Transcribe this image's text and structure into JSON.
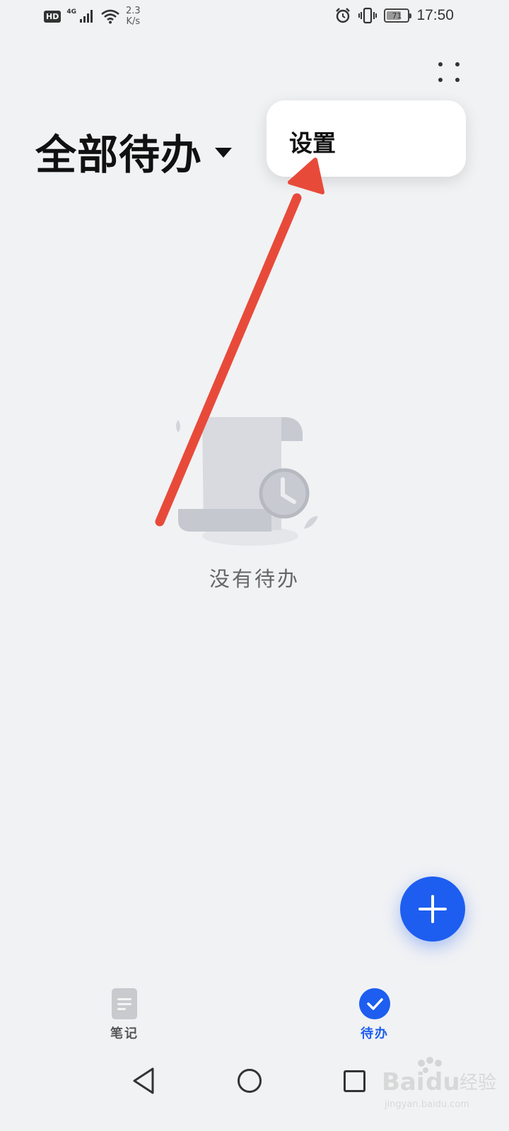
{
  "status_bar": {
    "hd": "HD",
    "network": "4G",
    "speed_value": "2.3",
    "speed_unit": "K/s",
    "battery_level": 71,
    "battery": "71",
    "time": "17:50"
  },
  "header": {
    "title": "全部待办"
  },
  "popup_menu": {
    "items": [
      {
        "label": "设置"
      }
    ]
  },
  "empty_state": {
    "text": "没有待办"
  },
  "bottom_tabs": [
    {
      "label": "笔记",
      "active": false
    },
    {
      "label": "待办",
      "active": true
    }
  ],
  "colors": {
    "accent": "#1d5ef0",
    "background": "#f1f2f4",
    "annotation_arrow": "#e84a3a"
  },
  "watermark": {
    "brand": "Baidu",
    "brand_cn": "经验",
    "url": "jingyan.baidu.com"
  }
}
